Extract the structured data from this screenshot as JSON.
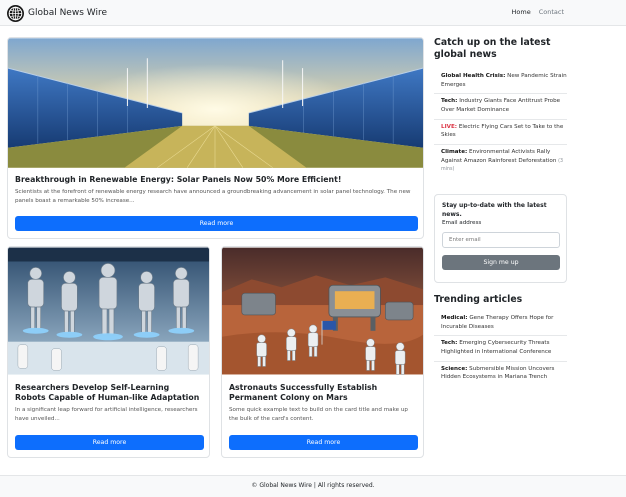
{
  "brand": {
    "name": "Global News Wire"
  },
  "nav": {
    "home": "Home",
    "contact": "Contact"
  },
  "featured": {
    "title": "Breakthrough in Renewable Energy: Solar Panels Now 50% More Efficient!",
    "text": "Scientists at the forefront of renewable energy research have announced a groundbreaking advancement in solar panel technology. The new panels boast a remarkable 50% increase...",
    "button": "Read more"
  },
  "cards": [
    {
      "title": "Researchers Develop Self-Learning Robots Capable of Human-like Adaptation",
      "text": "In a significant leap forward for artificial intelligence, researchers have unveiled...",
      "button": "Read more"
    },
    {
      "title": "Astronauts Successfully Establish Permanent Colony on Mars",
      "text": "Some quick example text to build on the card title and make up the bulk of the card's content.",
      "button": "Read more"
    }
  ],
  "catchup": {
    "heading": "Catch up on the latest global news",
    "items": [
      {
        "tag": "Global Health Crisis:",
        "text": "New Pandemic Strain Emerges"
      },
      {
        "tag": "Tech:",
        "text": "Industry Giants Face Antitrust Probe Over Market Dominance"
      },
      {
        "tag": "LIVE:",
        "text": "Electric Flying Cars Set to Take to the Skies"
      },
      {
        "tag": "Climate:",
        "text": "Environmental Activists Rally Against Amazon Rainforest Deforestation",
        "meta": "(3 mins)"
      }
    ]
  },
  "subscribe": {
    "title": "Stay up-to-date with the latest news.",
    "label": "Email address",
    "placeholder": "Enter email",
    "button": "Sign me up"
  },
  "trending": {
    "heading": "Trending articles",
    "items": [
      {
        "tag": "Medical:",
        "text": "Gene Therapy Offers Hope for Incurable Diseases"
      },
      {
        "tag": "Tech:",
        "text": "Emerging Cybersecurity Threats Highlighted in International Conference"
      },
      {
        "tag": "Science:",
        "text": "Submersible Mission Uncovers Hidden Ecosystems in Mariana Trench"
      }
    ]
  },
  "footer": {
    "text": "© Global News Wire | All rights reserved."
  },
  "colors": {
    "primary": "#0d6efd",
    "secondary": "#6c757d",
    "live": "#dc3545",
    "navbar": "#f8f9fa"
  }
}
